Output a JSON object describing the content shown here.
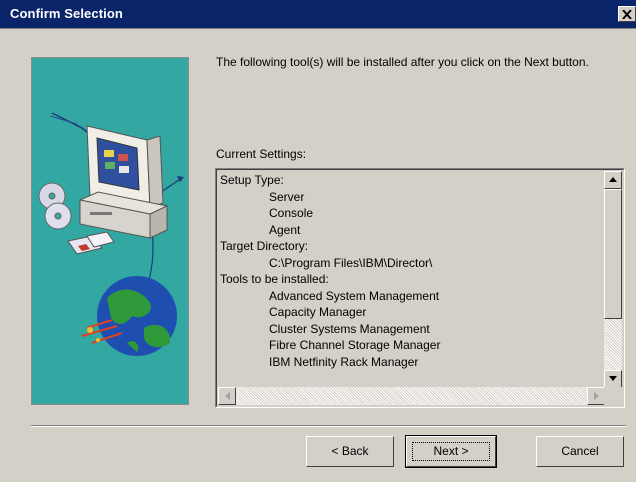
{
  "window": {
    "title": "Confirm Selection",
    "close_glyph": "×"
  },
  "message": "The following tool(s) will be installed after you click on the Next button.",
  "settings_label": "Current Settings:",
  "settings": [
    {
      "text": "Setup Type:",
      "indent": false
    },
    {
      "text": "Server",
      "indent": true
    },
    {
      "text": "Console",
      "indent": true
    },
    {
      "text": "Agent",
      "indent": true
    },
    {
      "text": "Target Directory:",
      "indent": false
    },
    {
      "text": "C:\\Program Files\\IBM\\Director\\",
      "indent": true
    },
    {
      "text": "Tools to be installed:",
      "indent": false
    },
    {
      "text": "Advanced System Management",
      "indent": true
    },
    {
      "text": "Capacity Manager",
      "indent": true
    },
    {
      "text": "Cluster Systems Management",
      "indent": true
    },
    {
      "text": "Fibre Channel Storage Manager",
      "indent": true
    },
    {
      "text": "IBM Netfinity Rack Manager",
      "indent": true
    }
  ],
  "buttons": {
    "back": "< Back",
    "next": "Next >",
    "cancel": "Cancel"
  },
  "illustration": {
    "icon": "computer-network-globe-illustration",
    "background": "#33a7a2"
  },
  "colors": {
    "titlebar": "#0a246a",
    "dialog": "#d4d0c8"
  }
}
